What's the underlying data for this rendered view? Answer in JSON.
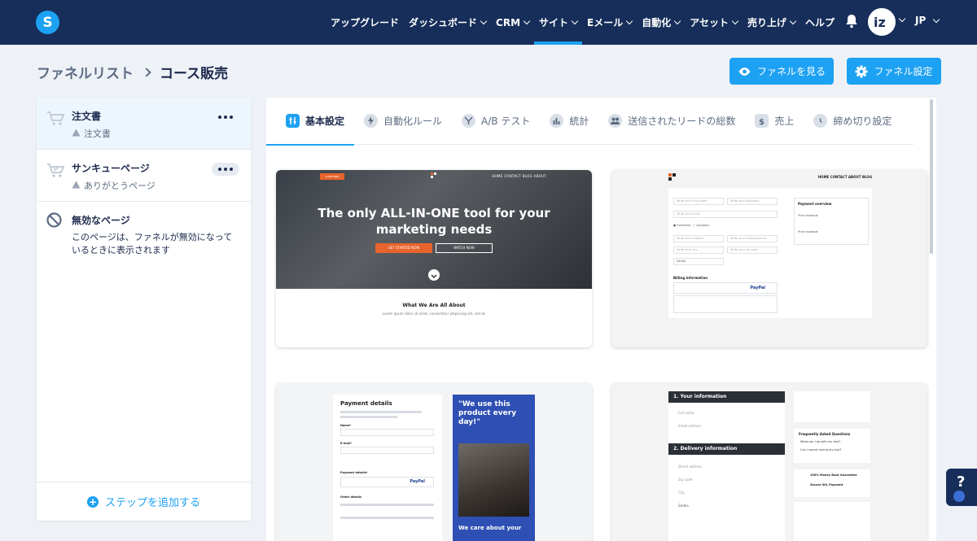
{
  "nav": {
    "items": [
      {
        "label": "アップグレード",
        "dropdown": false,
        "active": false
      },
      {
        "label": "ダッシュボード",
        "dropdown": true,
        "active": false
      },
      {
        "label": "CRM",
        "dropdown": true,
        "active": false
      },
      {
        "label": "サイト",
        "dropdown": true,
        "active": true
      },
      {
        "label": "Eメール",
        "dropdown": true,
        "active": false
      },
      {
        "label": "自動化",
        "dropdown": true,
        "active": false
      },
      {
        "label": "アセット",
        "dropdown": true,
        "active": false
      },
      {
        "label": "売り上げ",
        "dropdown": true,
        "active": false
      },
      {
        "label": "ヘルプ",
        "dropdown": false,
        "active": false
      }
    ],
    "lang": "JP",
    "logo_letter": "S"
  },
  "breadcrumb": {
    "parent": "ファネルリスト",
    "current": "コース販売"
  },
  "actions": {
    "view_label": "ファネルを見る",
    "settings_label": "ファネル設定"
  },
  "sidebar": {
    "steps": [
      {
        "title": "注文書",
        "subtitle": "注文書"
      },
      {
        "title": "サンキューページ",
        "subtitle": "ありがとうページ"
      }
    ],
    "invalid": {
      "title": "無効なページ",
      "desc_line1": "このページは、ファネルが無効になって",
      "desc_line2": "いるときに表示されます"
    },
    "add_step_label": "ステップを追加する"
  },
  "tabs": [
    {
      "label": "基本設定",
      "icon": "sliders-icon"
    },
    {
      "label": "自動化ルール",
      "icon": "bolt-icon"
    },
    {
      "label": "A/B テスト",
      "icon": "split-icon"
    },
    {
      "label": "統計",
      "icon": "bar-chart-icon"
    },
    {
      "label": "送信されたリードの総数",
      "icon": "users-icon"
    },
    {
      "label": "売上",
      "icon": "dollar-icon"
    },
    {
      "label": "締め切り設定",
      "icon": "clock-icon"
    }
  ],
  "templates": {
    "t1": {
      "badge": "SUBSCRIBE",
      "nav": "HOME   CONTACT   BLOG   ABOUT",
      "headline_1": "The only ALL-IN-ONE tool for your",
      "headline_2": "marketing needs",
      "cta_primary": "GET STARTED NOW",
      "cta_secondary": "WATCH NOW",
      "section_title": "What We Are All About",
      "section_sub": "Lorem ipsum dolor sit amet, consectetur adipiscing elit, sed do"
    },
    "t2": {
      "nav": "HOME   CONTACT   ABOUT   BLOG",
      "payment_overview": "Payment overview",
      "price_example": "Price example",
      "billing_info": "Billing information",
      "paypal": "PayPal",
      "fields": [
        "Write your first name",
        "Write your lastname",
        "Write your email",
        "Write your address",
        "Write your state/province",
        "Write your city",
        "Write your zip code",
        "Serbia"
      ],
      "radio_individual": "Individual",
      "radio_company": "Company"
    },
    "t3": {
      "payment_details": "Payment details",
      "quote_1": "\"We use this",
      "quote_2": "product every",
      "quote_3": "day!\"",
      "name_label": "Name*",
      "email_label": "E-mail*",
      "payment_details_label": "Payment details*",
      "order_details": "Order details",
      "paypal": "PayPal",
      "care": "We care about your"
    },
    "t4": {
      "your_info": "1. Your information",
      "delivery_info": "2. Delivery information",
      "faq": "Frequently Asked Questions",
      "q1": "What can I do with my trial?",
      "q2": "Can I cancel during my trial?",
      "guarantee": "100% Money Back Guarantee",
      "secure": "Secure SSL Payment",
      "full_name": "Full name",
      "email_address": "Email address",
      "street": "Street address",
      "zip": "Zip code",
      "city": "City",
      "country": "Serbia"
    }
  },
  "colors": {
    "nav_bg": "#162e59",
    "accent": "#1da1f2",
    "page_bg": "#eef2f7"
  }
}
